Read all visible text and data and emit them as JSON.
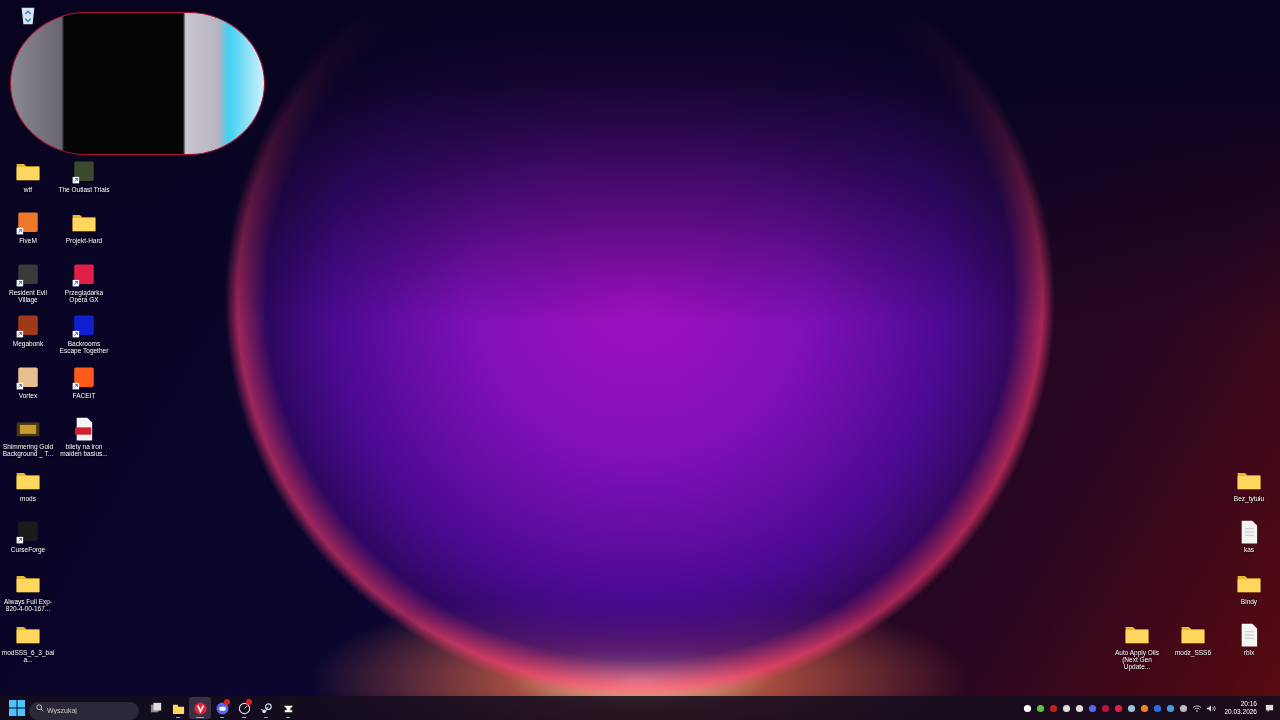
{
  "desktop": {
    "left_columns": [
      {
        "icons": [
          {
            "label": "wtf",
            "kind": "folder",
            "shortcut": false
          },
          {
            "label": "FiveM",
            "kind": "app",
            "color": "#f0782a",
            "shortcut": true
          },
          {
            "label": "Resident Evil Village",
            "kind": "app",
            "color": "#3a3a3a",
            "shortcut": true
          },
          {
            "label": "Megabonk",
            "kind": "app",
            "color": "#a0381a",
            "shortcut": true
          },
          {
            "label": "Vortex",
            "kind": "app",
            "color": "#e8c090",
            "shortcut": true
          },
          {
            "label": "Shimmering Gold Background _ T...",
            "kind": "video",
            "shortcut": false
          },
          {
            "label": "mods",
            "kind": "folder",
            "shortcut": false
          },
          {
            "label": "CurseForge",
            "kind": "app",
            "color": "#1a1a1a",
            "shortcut": true
          },
          {
            "label": "Always Full Exp-820-4-00-167...",
            "kind": "folder",
            "shortcut": false
          },
          {
            "label": "modSSS_6_3_bala...",
            "kind": "folder",
            "shortcut": false
          }
        ]
      },
      {
        "icons": [
          {
            "label": "The Outlast Trials",
            "kind": "app",
            "color": "#3a4a2a",
            "shortcut": true
          },
          {
            "label": "Projekt-Hard",
            "kind": "folder",
            "shortcut": false
          },
          {
            "label": "Przeglądarka Opera GX",
            "kind": "app",
            "color": "#e0204a",
            "shortcut": true
          },
          {
            "label": "Backrooms Escape Together",
            "kind": "app",
            "color": "#1020d0",
            "shortcut": true
          },
          {
            "label": "FACEIT",
            "kind": "app",
            "color": "#ff5a1a",
            "shortcut": true
          },
          {
            "label": "bilety na iron maiden basius...",
            "kind": "pdf",
            "shortcut": false
          }
        ]
      }
    ],
    "right_icons": [
      {
        "label": "Bez_tytułu",
        "kind": "folder",
        "shortcut": false
      },
      {
        "label": "kas",
        "kind": "document",
        "shortcut": false
      },
      {
        "label": "Bindy",
        "kind": "folder",
        "shortcut": false
      },
      {
        "label": "Auto Apply Oils (Next Gen Update...",
        "kind": "folder",
        "shortcut": false
      },
      {
        "label": "modz_SSS6",
        "kind": "folder",
        "shortcut": false
      },
      {
        "label": "rblx",
        "kind": "document",
        "shortcut": false
      }
    ]
  },
  "taskbar": {
    "search": {
      "placeholder": "Wyszukaj"
    },
    "apps": [
      {
        "kind": "taskview",
        "running": false,
        "active": false,
        "badge": false
      },
      {
        "kind": "explorer",
        "running": true,
        "active": false,
        "badge": false
      },
      {
        "kind": "browser",
        "running": true,
        "active": true,
        "badge": false
      },
      {
        "kind": "chat",
        "running": true,
        "active": false,
        "badge": true
      },
      {
        "kind": "clock",
        "running": true,
        "active": false,
        "badge": true
      },
      {
        "kind": "steam",
        "running": true,
        "active": false,
        "badge": false
      },
      {
        "kind": "anvil",
        "running": true,
        "active": false,
        "badge": false
      }
    ],
    "clock": {
      "time": "20:16",
      "date": "20.03.2026"
    }
  }
}
